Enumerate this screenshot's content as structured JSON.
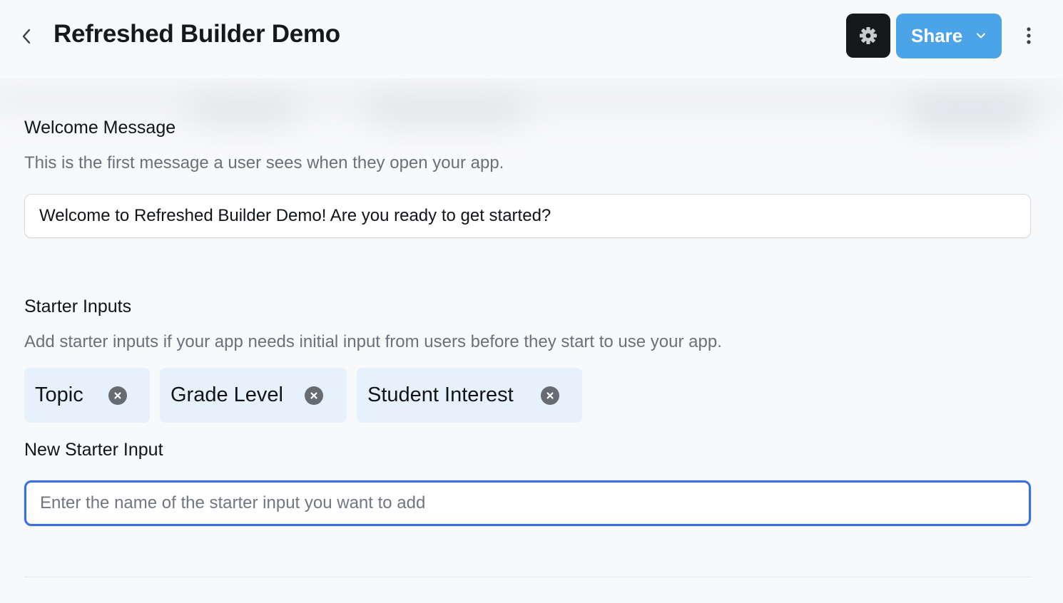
{
  "header": {
    "title": "Refreshed Builder Demo",
    "share_label": "Share"
  },
  "icons": {
    "back": "chevron-left-icon",
    "settings": "gear-icon",
    "share_menu": "chevron-down-icon",
    "more": "vertical-ellipsis-icon",
    "remove": "close-circle-icon"
  },
  "colors": {
    "accent": "#4ba3e8",
    "focus": "#3b6fe0",
    "chip_bg": "#e6f1fc",
    "dark_button": "#17181a"
  },
  "welcome": {
    "title": "Welcome Message",
    "description": "This is the first message a user sees when they open your app.",
    "value": "Welcome to Refreshed Builder Demo! Are you ready to get started?"
  },
  "starter_inputs": {
    "title": "Starter Inputs",
    "description": "Add starter inputs if your app needs initial input from users before they start to use your app.",
    "chips": [
      {
        "label": "Topic"
      },
      {
        "label": "Grade Level"
      },
      {
        "label": "Student Interest"
      }
    ]
  },
  "new_starter_input": {
    "title": "New Starter Input",
    "value": "",
    "placeholder": "Enter the name of the starter input you want to add"
  }
}
